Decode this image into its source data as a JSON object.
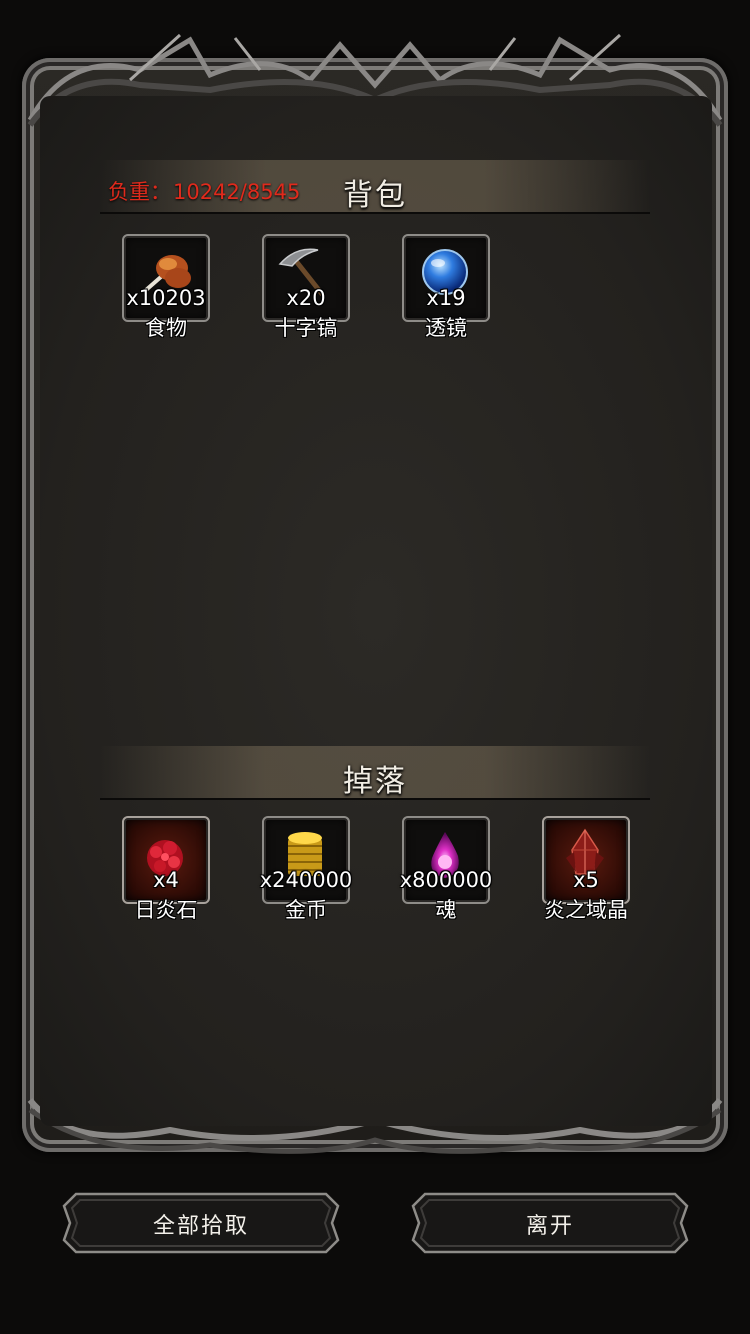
{
  "backpack": {
    "title": "背包",
    "weight_label": "负重：",
    "weight_value": "10242/8545",
    "items": [
      {
        "qty": "x10203",
        "name": "食物",
        "icon": "drumstick-icon"
      },
      {
        "qty": "x20",
        "name": "十字镐",
        "icon": "pickaxe-icon"
      },
      {
        "qty": "x19",
        "name": "透镜",
        "icon": "blue-orb-icon"
      }
    ]
  },
  "drops": {
    "title": "掉落",
    "items": [
      {
        "qty": "x4",
        "name": "日炎石",
        "icon": "red-ore-icon"
      },
      {
        "qty": "x240000",
        "name": "金币",
        "icon": "gold-coins-icon"
      },
      {
        "qty": "x800000",
        "name": "魂",
        "icon": "soul-flame-icon"
      },
      {
        "qty": "x5",
        "name": "炎之域晶",
        "icon": "red-crystal-icon"
      }
    ]
  },
  "buttons": {
    "pick_all": "全部拾取",
    "leave": "离开"
  },
  "colors": {
    "weight_text": "#e02a1c",
    "panel_bg": "#23211e",
    "frame_metal": "#7d7b78"
  }
}
